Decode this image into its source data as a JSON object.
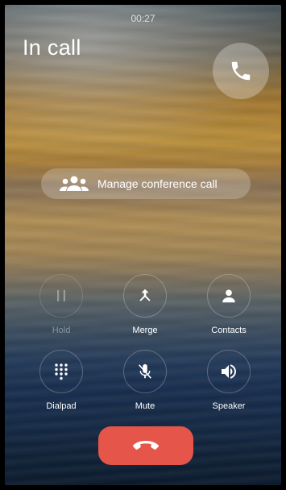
{
  "status": {
    "timer": "00:27"
  },
  "header": {
    "title": "In call"
  },
  "conference": {
    "label": "Manage conference call"
  },
  "controls": {
    "hold": {
      "label": "Hold",
      "enabled": false
    },
    "merge": {
      "label": "Merge"
    },
    "contacts": {
      "label": "Contacts"
    },
    "dialpad": {
      "label": "Dialpad"
    },
    "mute": {
      "label": "Mute"
    },
    "speaker": {
      "label": "Speaker"
    }
  },
  "colors": {
    "end_call": "#e5554a"
  },
  "icons": {
    "call_indicator": "phone-icon",
    "conference": "group-icon",
    "hold": "pause-icon",
    "merge": "merge-icon",
    "contacts": "person-icon",
    "dialpad": "dialpad-icon",
    "mute": "mic-off-icon",
    "speaker": "volume-icon",
    "end_call": "call-end-icon"
  }
}
